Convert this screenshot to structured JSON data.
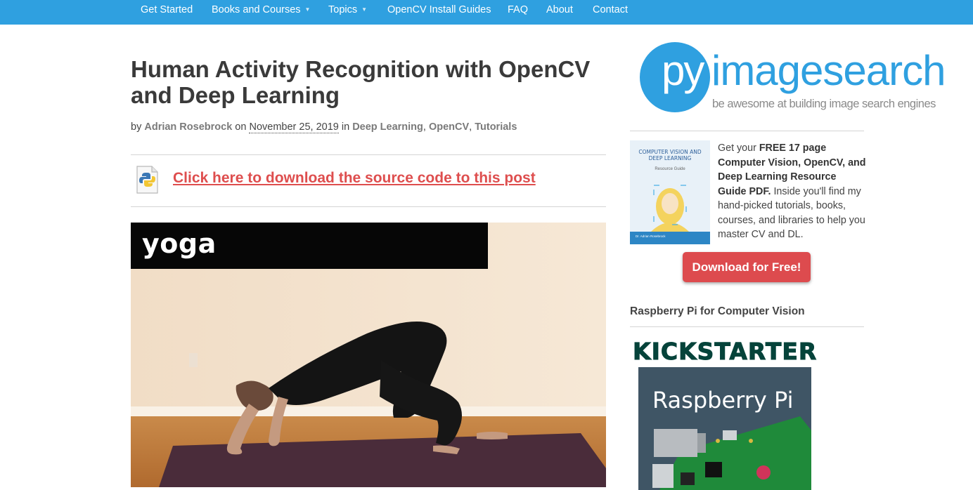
{
  "nav": {
    "items": [
      {
        "label": "Get Started",
        "dropdown": false
      },
      {
        "label": "Books and Courses",
        "dropdown": true
      },
      {
        "label": "Topics",
        "dropdown": true
      },
      {
        "label": "OpenCV Install Guides",
        "dropdown": false
      },
      {
        "label": "FAQ",
        "dropdown": false
      },
      {
        "label": "About",
        "dropdown": false
      },
      {
        "label": "Contact",
        "dropdown": false
      }
    ],
    "color": "#2fa0e0"
  },
  "post": {
    "title": "Human Activity Recognition with OpenCV and Deep Learning",
    "by": "by",
    "author": "Adrian Rosebrock",
    "on": "on",
    "date": "November 25, 2019",
    "in": "in",
    "categories": [
      "Deep Learning",
      "OpenCV",
      "Tutorials"
    ],
    "download_link": "Click here to download the source code to this post",
    "hero_label": "yoga"
  },
  "sidebar": {
    "logo": {
      "prefix": "py",
      "word": "imagesearch",
      "tagline": "be awesome at building image search engines"
    },
    "promo": {
      "intro": "Get your",
      "bold": "FREE 17 page Computer Vision, OpenCV, and Deep Learning Resource Guide PDF.",
      "rest": "Inside you'll find my hand-picked tutorials, books, courses, and libraries to help you master CV and DL.",
      "button": "Download for Free!",
      "book_title": "COMPUTER VISION AND DEEP LEARNING",
      "book_sub": "Resource Guide",
      "book_author": "Dr. Adrian Rosebrock"
    },
    "rpi_section": {
      "heading": "Raspberry Pi for Computer Vision",
      "kickstarter": "KICKSTARTER",
      "cover_title": "Raspberry Pi"
    }
  },
  "colors": {
    "accent": "#2fa0e0",
    "link_red": "#de4e4e",
    "button_red": "#dd4b4e"
  }
}
